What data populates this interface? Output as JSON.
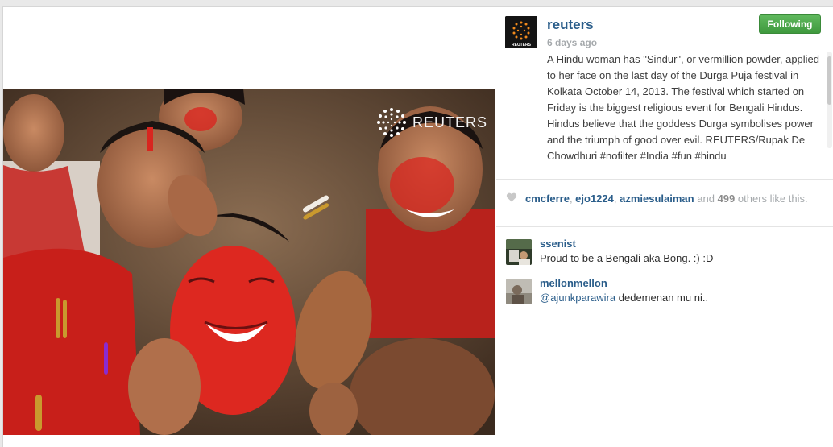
{
  "post": {
    "username": "reuters",
    "avatar_brand": "REUTERS",
    "time_ago": "6 days ago",
    "follow_label": "Following",
    "caption": "A Hindu woman has \"Sindur\", or vermillion powder, applied to her face on the last day of the Durga Puja festival in Kolkata October 14, 2013. The festival which started on Friday is the biggest religious event for Bengali Hindus. Hindus believe that the goddess Durga symbolises power and the triumph of good over evil. REUTERS/Rupak De Chowdhuri #nofilter #India #fun #hindu",
    "watermark": "REUTERS"
  },
  "likes": {
    "icon": "heart-icon",
    "likers": [
      "cmcferre",
      "ejo1224",
      "azmiesulaiman"
    ],
    "separator": ", ",
    "and_text": "and",
    "count": "499",
    "suffix": "others like this."
  },
  "comments": [
    {
      "user": "ssenist",
      "mention": "",
      "text": "Proud to be a Bengali aka Bong. :) :D"
    },
    {
      "user": "mellonmellon",
      "mention": "@ajunkparawira",
      "text": "dedemenan mu ni.."
    }
  ],
  "colors": {
    "link": "#2a5d8a",
    "follow_green": "#4caa4a",
    "muted": "#a5a9ac",
    "vermillion": "#e1271f"
  }
}
